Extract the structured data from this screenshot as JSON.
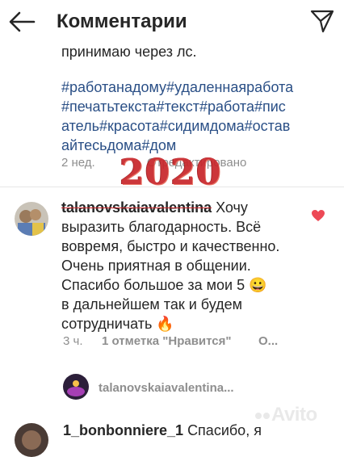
{
  "header": {
    "title": "Комментарии",
    "back_icon": "arrow-left-icon",
    "send_icon": "paper-plane-icon"
  },
  "caption": {
    "first_line": "принимаю через лс.",
    "hashtag_lines": [
      "#работанадому#удаленнаяработа",
      "#печатьтекста#текст#работа#пис",
      "атель#красота#сидимдома#остав",
      "айтесьдома#дом"
    ],
    "time": "2 нед.",
    "edited": "Отредактировано",
    "stamp_year": "2020"
  },
  "comment": {
    "username": "talanovskaiavalentina",
    "text_lines": [
      "Хочу",
      "выразить благодарность. Всё",
      "вовремя, быстро и качественно.",
      "Очень приятная в общении.",
      "Спасибо большое за мои 5 😀",
      "в дальнейшем так и будем",
      "сотрудничать 🔥"
    ],
    "time": "3 ч.",
    "likes": "1 отметка \"Нравится\"",
    "reply": "О..."
  },
  "reply_row": {
    "username": "talanovskaiavalentina..."
  },
  "next_comment": {
    "username": "1_bonbonniere_1",
    "text": "Спасибо, я"
  },
  "watermark": {
    "text": "Avito"
  },
  "colors": {
    "hashtag": "#2a4f86",
    "heart": "#ed4956",
    "stamp": "#c8262a",
    "meta": "#8e8e8e"
  }
}
